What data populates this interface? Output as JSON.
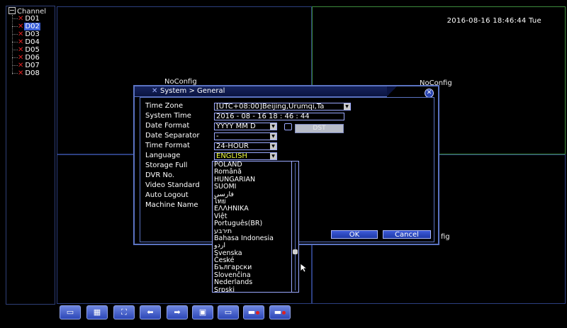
{
  "channel_panel": {
    "header": "Channel",
    "items": [
      {
        "label": "D01",
        "selected": false
      },
      {
        "label": "D02",
        "selected": true
      },
      {
        "label": "D03",
        "selected": false
      },
      {
        "label": "D04",
        "selected": false
      },
      {
        "label": "D05",
        "selected": false
      },
      {
        "label": "D06",
        "selected": false
      },
      {
        "label": "D07",
        "selected": false
      },
      {
        "label": "D08",
        "selected": false
      }
    ]
  },
  "video": {
    "datetime": "2016-08-16 18:46:44 Tue",
    "noconfig_1": "NoConfig",
    "noconfig_2": "NoConfig",
    "noconfig_3_partial": "fig"
  },
  "dialog": {
    "title": "System > General",
    "labels": {
      "time_zone": "Time Zone",
      "system_time": "System Time",
      "date_format": "Date Format",
      "date_separator": "Date Separator",
      "time_format": "Time Format",
      "language": "Language",
      "storage_full": "Storage Full",
      "dvr_no": "DVR No.",
      "video_standard": "Video Standard",
      "auto_logout": "Auto Logout",
      "machine_name": "Machine Name"
    },
    "values": {
      "time_zone": "[UTC+08:00]Beijing,Urumqi,Ta",
      "system_time": "2016 - 08 - 16   18 : 46 : 44",
      "date_format": "YYYY MM D",
      "date_separator": "-",
      "time_format": "24-HOUR",
      "language": "ENGLISH"
    },
    "dst_button": "DST",
    "ok_button": "OK",
    "cancel_button": "Cancel"
  },
  "language_options": [
    "POLAND",
    "Română",
    "HUNGARIAN",
    "SUOMI",
    "فارسی",
    "ไทย",
    "ΕΛΛΗΝΙΚΑ",
    "Việt",
    "Português(BR)",
    "תירבע",
    "Bahasa Indonesia",
    "اردو",
    "Svenska",
    "České",
    "Български",
    "Slovenčina",
    "Nederlands",
    "Srpski"
  ],
  "toolbar": {
    "icons": [
      "single-view-icon",
      "quad-view-icon",
      "fullscreen-icon",
      "previous-icon",
      "next-icon",
      "playback-icon",
      "monitor-icon",
      "record-icon",
      "record-stop-icon"
    ]
  },
  "colors": {
    "accent_blue": "#3a5fd9",
    "grid_border": "#2c3f80",
    "active_pane_border": "#3c8a3c",
    "channel_offline": "#e02020",
    "language_value": "#f0ff40"
  }
}
